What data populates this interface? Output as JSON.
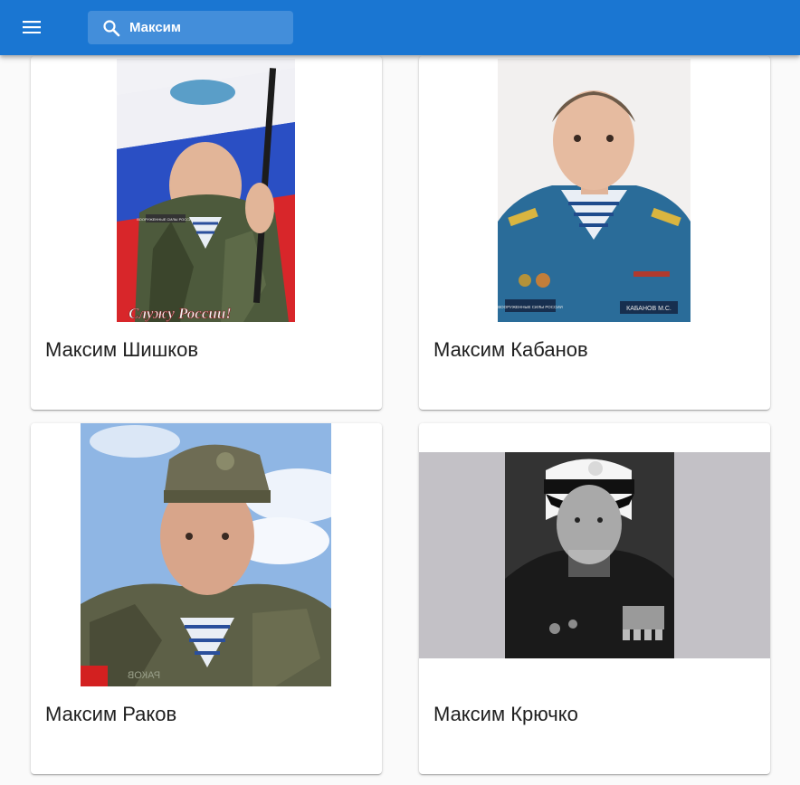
{
  "search": {
    "value": "Максим"
  },
  "cards": [
    {
      "name": "Максим Шишков",
      "photo_caption": "Служу России!",
      "patch_left": "ВООРУЖЕННЫЕ СИЛЫ РОССИИ"
    },
    {
      "name": "Максим Кабанов",
      "patch_left": "ВООРУЖЕННЫЕ СИЛЫ РОССИИ",
      "patch_right": "КАБАНОВ М.С."
    },
    {
      "name": "Максим Раков",
      "patch_left": "РАКОВ"
    },
    {
      "name": "Максим Крючко"
    }
  ],
  "colors": {
    "appbar": "#1a76d2",
    "background": "#fafafa",
    "card": "#ffffff"
  },
  "icons": {
    "menu": "menu-icon",
    "search": "search-icon"
  }
}
